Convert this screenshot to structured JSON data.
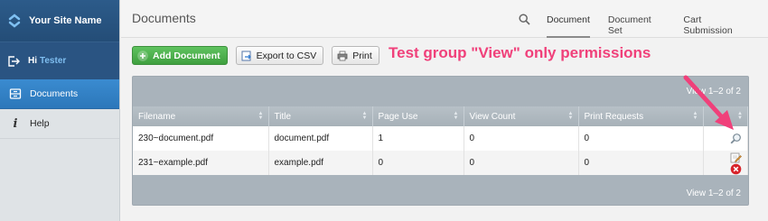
{
  "sidebar": {
    "site_name": "Your Site Name",
    "greeting": "Hi",
    "user_name": "Tester",
    "items": [
      {
        "label": "Documents",
        "icon": "drawer-icon"
      },
      {
        "label": "Help",
        "icon": "info-icon"
      }
    ]
  },
  "header": {
    "title": "Documents",
    "tabs": [
      "Document",
      "Document Set",
      "Cart Submission"
    ]
  },
  "toolbar": {
    "add_label": "Add Document",
    "export_label": "Export to CSV",
    "print_label": "Print"
  },
  "annotation": "Test group \"View\" only permissions",
  "grid": {
    "pager_top": "View 1–2 of 2",
    "pager_bottom": "View 1–2 of 2",
    "columns": [
      "Filename",
      "Title",
      "Page Use",
      "View Count",
      "Print Requests",
      ""
    ],
    "rows": [
      {
        "filename": "230~document.pdf",
        "title": "document.pdf",
        "page_use": "1",
        "view_count": "0",
        "print_requests": "0",
        "actions": [
          "view-icon"
        ]
      },
      {
        "filename": "231~example.pdf",
        "title": "example.pdf",
        "page_use": "0",
        "view_count": "0",
        "print_requests": "0",
        "actions": [
          "edit-icon",
          "delete-icon"
        ]
      }
    ]
  },
  "colors": {
    "brand": "#2a5482",
    "active_nav": "#3a8bd0",
    "add_button": "#4fb14f",
    "annotation": "#f0407a",
    "grid_header": "#a9b3bb"
  }
}
